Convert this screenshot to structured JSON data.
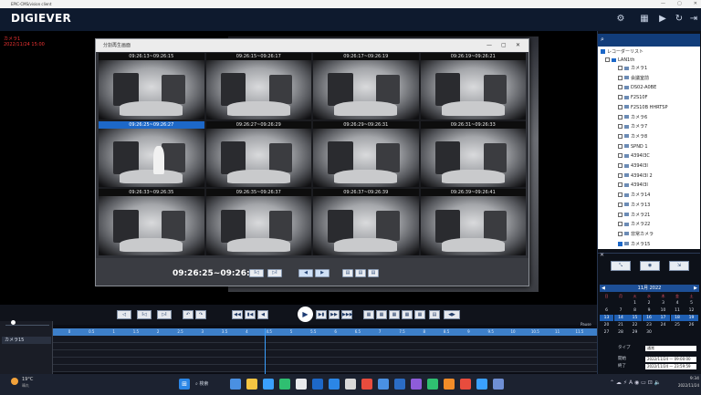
{
  "window": {
    "title": "EPIC-CMS/vision client",
    "controls": [
      "—",
      "▢",
      "✕"
    ]
  },
  "app": {
    "logo": "DIGIEVER",
    "toolbar": [
      {
        "name": "gear-icon",
        "glyph": "⚙"
      },
      {
        "name": "layout-icon",
        "glyph": "▦"
      },
      {
        "name": "playback-icon",
        "glyph": "▶"
      },
      {
        "name": "refresh-icon",
        "glyph": "↻"
      },
      {
        "name": "logout-icon",
        "glyph": "⇥"
      }
    ]
  },
  "camera_overlay": {
    "line1": "カメラ1",
    "line2": "2022/11/24 15:00"
  },
  "dialog": {
    "title": "分割再生画面",
    "controls": [
      "—",
      "▢",
      "✕"
    ],
    "tiles": [
      {
        "time": "09:26:13~09:26:15",
        "selected": false,
        "person": false
      },
      {
        "time": "09:26:15~09:26:17",
        "selected": false,
        "person": false
      },
      {
        "time": "09:26:17~09:26:19",
        "selected": false,
        "person": false
      },
      {
        "time": "09:26:19~09:26:21",
        "selected": false,
        "person": false
      },
      {
        "time": "09:26:25~09:26:27",
        "selected": true,
        "person": true
      },
      {
        "time": "09:26:27~09:26:29",
        "selected": false,
        "person": false
      },
      {
        "time": "09:26:29~09:26:31",
        "selected": false,
        "person": false
      },
      {
        "time": "09:26:31~09:26:33",
        "selected": false,
        "person": false
      },
      {
        "time": "09:26:33~09:26:35",
        "selected": false,
        "person": false
      },
      {
        "time": "09:26:35~09:26:37",
        "selected": false,
        "person": false
      },
      {
        "time": "09:26:37~09:26:39",
        "selected": false,
        "person": false
      },
      {
        "time": "09:26:39~09:26:41",
        "selected": false,
        "person": false
      }
    ],
    "current_time": "09:26:25~09:26:27",
    "buttons": [
      "I◁",
      "▷I",
      "◀",
      "▶",
      "▤",
      "▤",
      "▤"
    ]
  },
  "controls": {
    "buttons": [
      "◁",
      "I◁",
      "▷I",
      "↶",
      "↷",
      "◀◀",
      "▮◀",
      "◀",
      "▶",
      "▶▮",
      "▶▶",
      "▶▶▶",
      "▦",
      "▦",
      "▦",
      "▦",
      "▦",
      "▤",
      "◀▶"
    ]
  },
  "timeline": {
    "camera": "カメラ15",
    "hours": [
      "0",
      "0.5",
      "1",
      "1.5",
      "2",
      "2.5",
      "3",
      "3.5",
      "4",
      "4.5",
      "5",
      "5.5",
      "6",
      "6.5",
      "7",
      "7.5",
      "8",
      "8.5",
      "9",
      "9.5",
      "10",
      "10.5",
      "11",
      "11.5",
      "12"
    ],
    "pause_label": "Pause"
  },
  "tree": {
    "root": "レコーダーリスト",
    "group": "LAN1th",
    "items": [
      {
        "label": "カメラ1",
        "checked": false
      },
      {
        "label": "会議室前",
        "checked": false
      },
      {
        "label": "DS02-A0BE",
        "checked": false
      },
      {
        "label": "F2S10F",
        "checked": false
      },
      {
        "label": "F2S10B HHRTSP",
        "checked": false
      },
      {
        "label": "カメラ6",
        "checked": false
      },
      {
        "label": "カメラ7",
        "checked": false
      },
      {
        "label": "カメラ8",
        "checked": false
      },
      {
        "label": "SPND 1",
        "checked": false
      },
      {
        "label": "4394I3C",
        "checked": false
      },
      {
        "label": "4394I3I",
        "checked": false
      },
      {
        "label": "4394I3I 2",
        "checked": false
      },
      {
        "label": "4394I3I",
        "checked": false
      },
      {
        "label": "カメラ14",
        "checked": false
      },
      {
        "label": "カメラ13",
        "checked": false
      },
      {
        "label": "カメラ21",
        "checked": false
      },
      {
        "label": "カメラ22",
        "checked": false
      },
      {
        "label": "非常カメラ",
        "checked": false
      },
      {
        "label": "カメラ15",
        "checked": true
      }
    ]
  },
  "calendar": {
    "title": "11月 2022",
    "weekdays": [
      "日",
      "月",
      "火",
      "水",
      "木",
      "金",
      "土"
    ],
    "days": [
      [
        "",
        "",
        "1",
        "2",
        "3",
        "4",
        "5"
      ],
      [
        "6",
        "7",
        "8",
        "9",
        "10",
        "11",
        "12"
      ],
      [
        "13",
        "14",
        "15",
        "16",
        "17",
        "18",
        "19"
      ],
      [
        "20",
        "21",
        "22",
        "23",
        "24",
        "25",
        "26"
      ],
      [
        "27",
        "28",
        "29",
        "30",
        "",
        "",
        ""
      ]
    ],
    "highlight_row": 2
  },
  "search": {
    "type_label": "タイプ",
    "type_value": "通常",
    "start_label": "開始",
    "start_value": "2022/11/24 — 09:00:00",
    "end_label": "終了",
    "end_value": "2022/11/24 — 23:59:59"
  },
  "taskbar": {
    "weather": "19°C",
    "weather_sub": "晴れ",
    "search_placeholder": "検索",
    "clock_time": "9:34",
    "clock_date": "2022/11/24"
  }
}
